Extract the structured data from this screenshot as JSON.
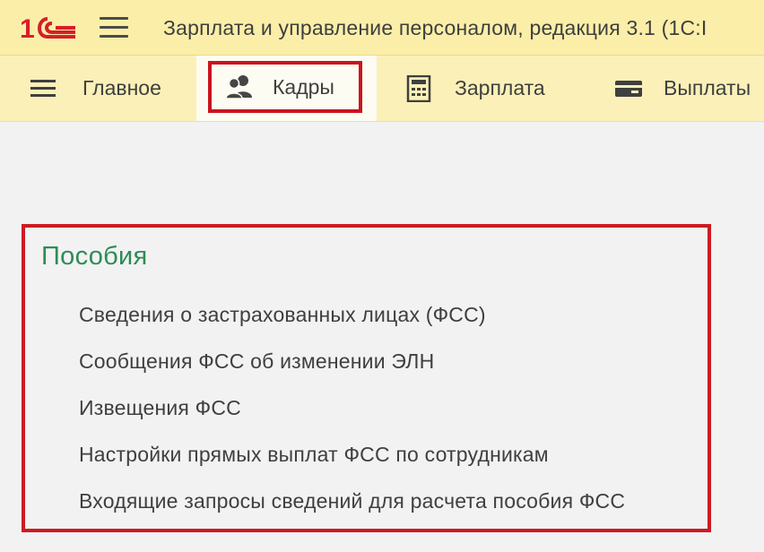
{
  "titlebar": {
    "title": "Зарплата и управление персоналом, редакция 3.1  (1С:I",
    "logo_icon": "1c-logo-icon",
    "menu_icon": "hamburger-icon"
  },
  "sections": [
    {
      "label": "Главное",
      "icon": "list-icon"
    },
    {
      "label": "Кадры",
      "icon": "people-icon",
      "selected": true
    },
    {
      "label": "Зарплата",
      "icon": "calculator-icon"
    },
    {
      "label": "Выплаты",
      "icon": "wallet-icon"
    }
  ],
  "group": {
    "title": "Пособия",
    "items": [
      "Сведения о застрахованных лицах (ФСС)",
      "Сообщения ФСС об изменении ЭЛН",
      "Извещения ФСС",
      "Настройки прямых выплат ФСС по сотрудникам",
      "Входящие запросы сведений для расчета пособия ФСС"
    ]
  },
  "colors": {
    "titlebar_bg": "#fbeea8",
    "sections_bg": "#fbf0b8",
    "highlight_border": "#c9141d",
    "group_title": "#2e8b57",
    "logo_red": "#d51f2a"
  }
}
